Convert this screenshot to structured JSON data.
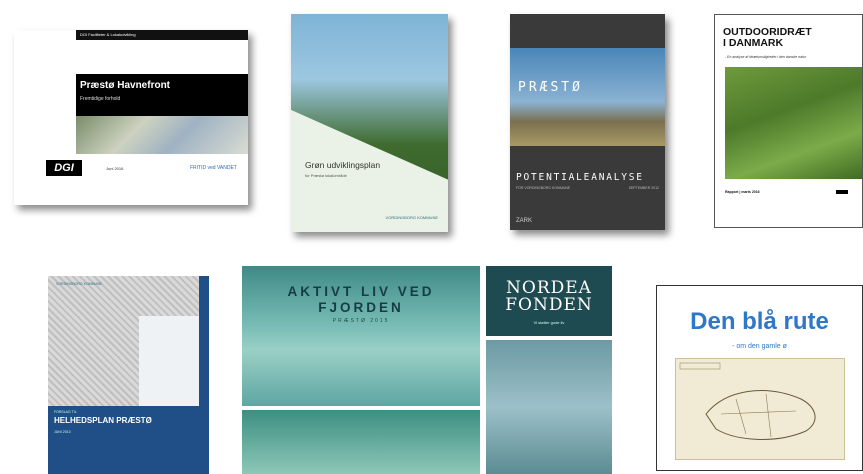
{
  "documents": {
    "d1": {
      "header": "DGI Faciliteter & Lokaludvikling",
      "title": "Præstø Havnefront",
      "subtitle": "Fremtidige forhold",
      "logo_left": "DGI",
      "date": "Juni 2016",
      "logo_right": "FRITID ved VANDET"
    },
    "d2": {
      "title": "Grøn udviklingsplan",
      "subtitle": "for Præstø lokalområde",
      "logo": "VORDINGBORG KOMMUNE"
    },
    "d3": {
      "title": "PRÆSTØ",
      "subtitle": "POTENTIALEANALYSE",
      "meta_left": "FOR VORDINGBORG KOMMUNE",
      "meta_right": "SEPTEMBER 2012",
      "logo": "ZARK"
    },
    "d4": {
      "title": "OUTDOORIDRÆT\nI DANMARK",
      "subtitle": "- En analyse af idrætsmuligheder i den danske natur",
      "report": "Rapport | marts 2016"
    },
    "d5": {
      "logo": "VORDINGBORG KOMMUNE",
      "small": "FORSLAG TIL",
      "title": "HELHEDSPLAN PRÆSTØ",
      "date": "JUNI 2013"
    },
    "d6": {
      "title_line1": "AKTIVT LIV VED",
      "title_line2": "FJORDEN",
      "subtitle": "PRÆSTØ 2015",
      "brand_line1": "NORDEA",
      "brand_line2": "FONDEN",
      "brand_tagline": "Vi støtter gode liv"
    },
    "d7": {
      "title": "Den blå rute",
      "subtitle": "- om den gamle ø"
    }
  },
  "colors": {
    "d7_title": "#2e78c8",
    "d5_blue": "#1f4f86",
    "d6_nordea": "#1e4a52"
  }
}
